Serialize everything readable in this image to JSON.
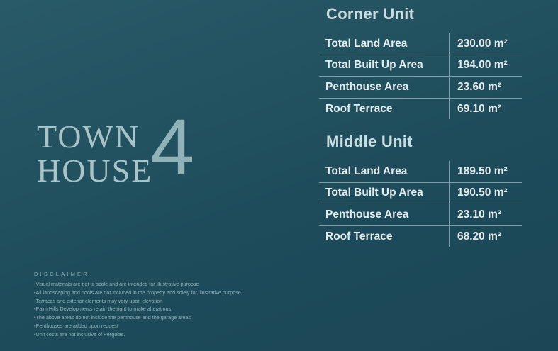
{
  "brand": {
    "line1": "TOWN",
    "line2": "HOUSE",
    "number": "4"
  },
  "corner_unit": {
    "title": "Corner Unit",
    "rows": [
      {
        "label": "Total Land Area",
        "value": "230.00 m²"
      },
      {
        "label": "Total Built Up Area",
        "value": "194.00 m²"
      },
      {
        "label": "Penthouse Area",
        "value": "23.60 m²"
      },
      {
        "label": "Roof Terrace",
        "value": "69.10 m²"
      }
    ]
  },
  "middle_unit": {
    "title": "Middle Unit",
    "rows": [
      {
        "label": "Total Land Area",
        "value": "189.50 m²"
      },
      {
        "label": "Total Built Up Area",
        "value": "190.50 m²"
      },
      {
        "label": "Penthouse Area",
        "value": "23.10 m²"
      },
      {
        "label": "Roof Terrace",
        "value": "68.20 m²"
      }
    ]
  },
  "disclaimer": {
    "heading": "DISCLAIMER",
    "items": [
      "Visual materials are not to scale and are intended for illustrative purpose",
      "All landscaping and pools are not included in the property and solely for illustrative purpose",
      "Terraces and exterior elements may vary upon elevation",
      "Palm Hills Developments retain the right to make alterations",
      "The above areas do not include the penthouse and the garage areas",
      "Penthouses are added upon request",
      "Unit costs are not inclusive of Pergolas."
    ]
  },
  "colors": {
    "background": "#1e4c5b",
    "text": "#e3ecee",
    "brand": "#a9c4c8"
  }
}
